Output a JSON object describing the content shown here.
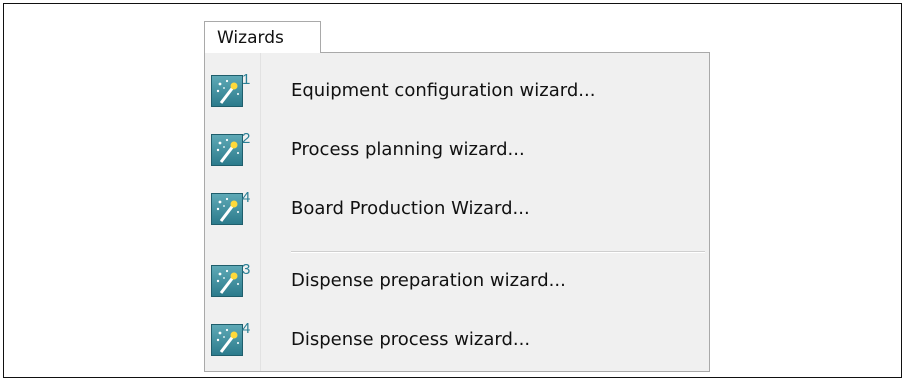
{
  "menu": {
    "title": "Wizards",
    "items": [
      {
        "label": "Equipment configuration wizard...",
        "icon": "wizard-wand-icon",
        "icon_number": "1"
      },
      {
        "label": "Process planning wizard...",
        "icon": "wizard-wand-icon",
        "icon_number": "2"
      },
      {
        "label": "Board Production Wizard...",
        "icon": "wizard-wand-icon",
        "icon_number": "4"
      },
      {
        "label": "Dispense preparation wizard...",
        "icon": "wizard-wand-icon",
        "icon_number": "3"
      },
      {
        "label": "Dispense process wizard...",
        "icon": "wizard-wand-icon",
        "icon_number": "4"
      }
    ]
  },
  "colors": {
    "icon_tile": "#3f8fa0",
    "icon_number": "#2a7f95",
    "menu_background": "#f0f0f0",
    "border": "#a9a9a9"
  }
}
